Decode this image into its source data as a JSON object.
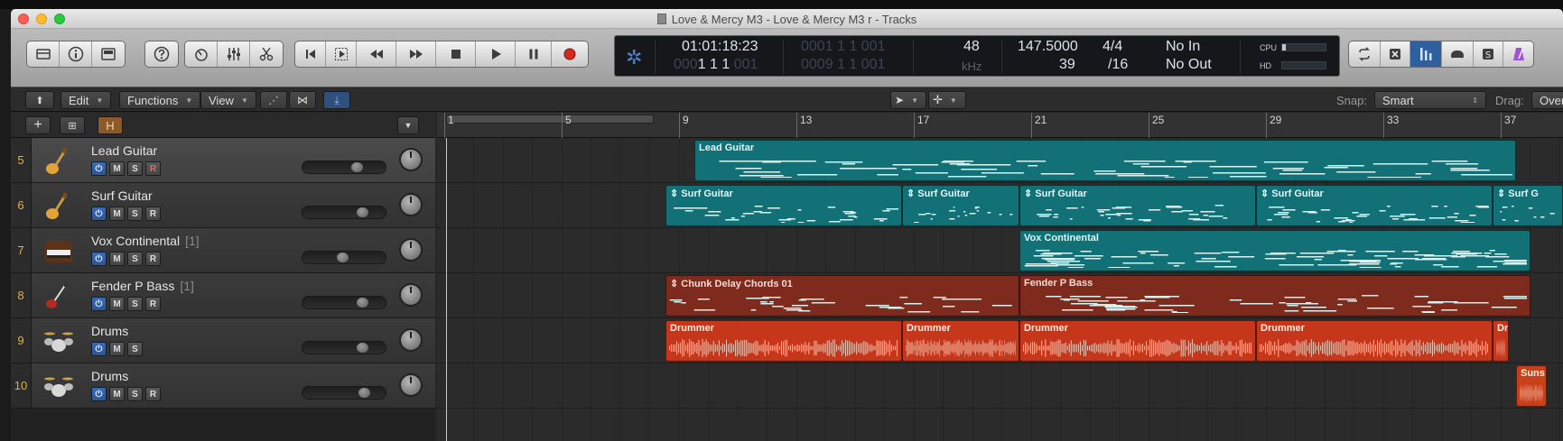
{
  "window": {
    "title": "Love & Mercy M3 - Love & Mercy M3 r - Tracks"
  },
  "lcd": {
    "position_smpte": "01:01:18:23",
    "position_bars_dim": "0001 1 1 001",
    "position_bars": "0001 1 1 001",
    "locator_main": "1 1 1",
    "locator_dim_prefix": "000",
    "locator_dim_suffix": "001",
    "locator_right_dim": "0009 1 1 001",
    "sample_rate": "48",
    "sample_rate_unit": "kHz",
    "tempo": "147.5000",
    "tempo_sub": "39",
    "time_sig": "4/4",
    "division": "/16",
    "midi_in": "No In",
    "midi_out": "No Out",
    "cpu_label": "CPU",
    "hd_label": "HD",
    "cpu_level": 0.08,
    "hd_level": 0.0
  },
  "toolbar": {
    "edit": "Edit",
    "functions": "Functions",
    "view": "View",
    "snap_label": "Snap:",
    "snap_value": "Smart",
    "drag_label": "Drag:",
    "drag_value": "Over"
  },
  "track_header": {
    "h_button": "H"
  },
  "ruler": {
    "bars": [
      "1",
      "5",
      "9",
      "13",
      "17",
      "21",
      "25",
      "29",
      "33",
      "37"
    ]
  },
  "tracks": [
    {
      "num": "5",
      "name": "Lead Guitar",
      "count": "",
      "buttons": [
        "M",
        "S",
        "R"
      ]
    },
    {
      "num": "6",
      "name": "Surf Guitar",
      "count": "",
      "buttons": [
        "M",
        "S",
        "R"
      ]
    },
    {
      "num": "7",
      "name": "Vox Continental",
      "count": "[1]",
      "buttons": [
        "M",
        "S",
        "R"
      ]
    },
    {
      "num": "8",
      "name": "Fender P Bass",
      "count": "[1]",
      "buttons": [
        "M",
        "S",
        "R"
      ]
    },
    {
      "num": "9",
      "name": "Drums",
      "count": "",
      "buttons": [
        "M",
        "S"
      ]
    },
    {
      "num": "10",
      "name": "Drums",
      "count": "",
      "buttons": [
        "M",
        "S",
        "R"
      ]
    }
  ],
  "regions": {
    "lead": "Lead Guitar",
    "surf": "Surf Guitar",
    "surf_cut": "Surf G",
    "vox": "Vox Continental",
    "chunk": "Chunk Delay Chords 01",
    "bass": "Fender P Bass",
    "drummer": "Drummer",
    "drummer_cut": "Dr",
    "sunset": "Suns"
  },
  "colors": {
    "midi_region": "#117177",
    "bass_region": "#7e2b1e",
    "drummer_region": "#c6361a",
    "track_number": "#e2b13b",
    "power_button": "#3b6bb4"
  }
}
